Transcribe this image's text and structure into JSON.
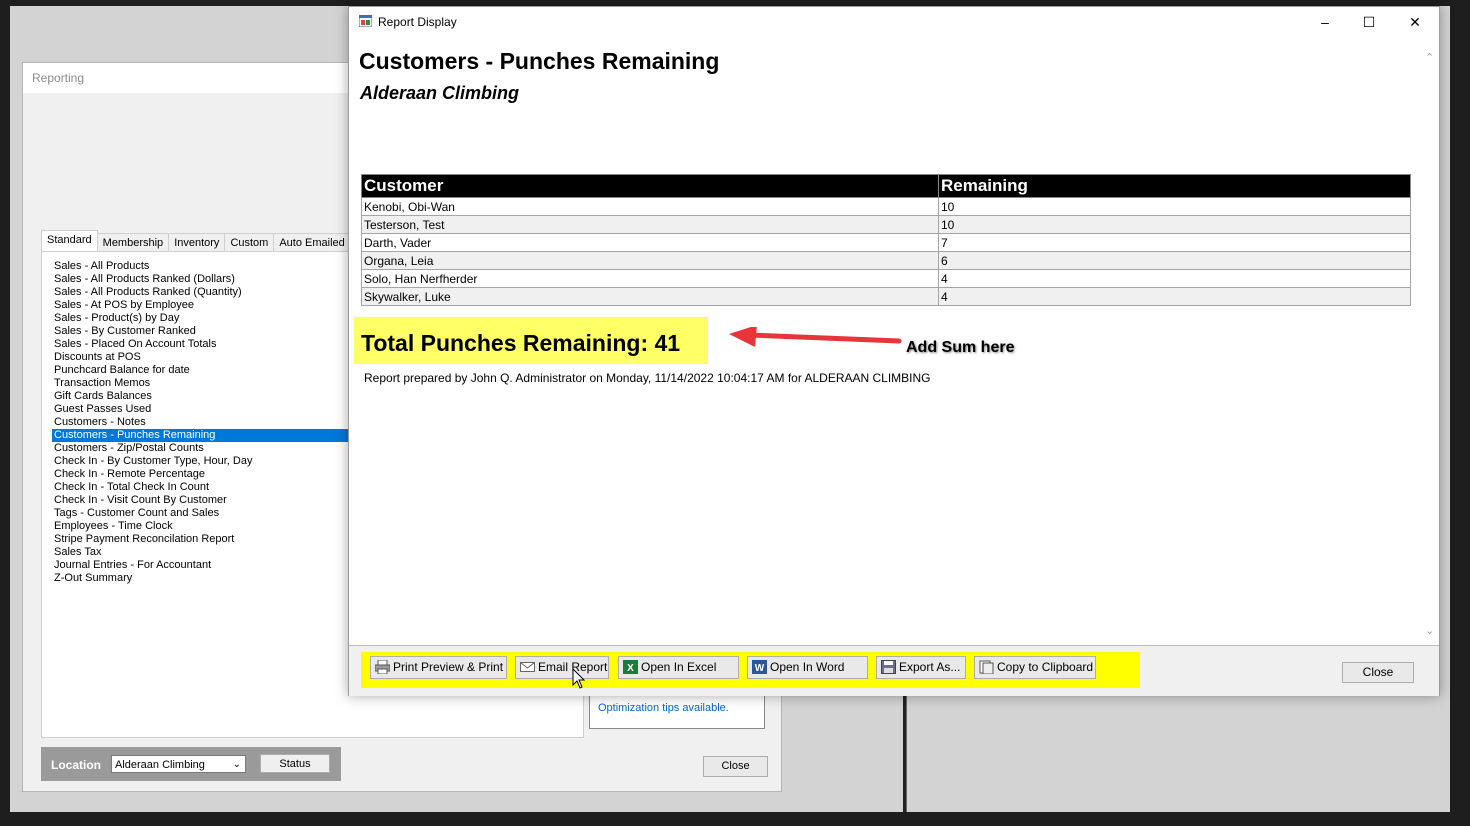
{
  "reporting": {
    "title": "Reporting",
    "tabs": [
      "Standard",
      "Membership",
      "Inventory",
      "Custom",
      "Auto Emailed R"
    ],
    "reports": [
      "Sales - All Products",
      "Sales - All Products Ranked (Dollars)",
      "Sales - All Products Ranked (Quantity)",
      "Sales - At POS by Employee",
      "Sales - Product(s) by Day",
      "Sales - By Customer Ranked",
      "Sales - Placed On Account Totals",
      "Discounts at POS",
      "Punchcard Balance for date",
      "Transaction Memos",
      "Gift Cards Balances",
      "Guest Passes Used",
      "Customers - Notes",
      "Customers - Punches Remaining",
      "Customers - Zip/Postal Counts",
      "Check In - By Customer Type, Hour, Day",
      "Check In - Remote Percentage",
      "Check In - Total Check In Count",
      "Check In - Visit Count By Customer",
      "Tags - Customer Count and Sales",
      "Employees - Time Clock",
      "Stripe Payment Reconcilation Report",
      "Sales Tax",
      "Journal Entries - For Accountant",
      "Z-Out Summary"
    ],
    "selected_report": "Customers - Punches Remaining",
    "optimization_tips": "Optimization tips available.",
    "location_label": "Location",
    "location_value": "Alderaan Climbing",
    "status_label": "Status",
    "close_label": "Close"
  },
  "report_window": {
    "title": "Report Display",
    "report_title": "Customers - Punches Remaining",
    "report_subtitle": "Alderaan Climbing",
    "columns": [
      "Customer",
      "Remaining"
    ],
    "rows": [
      [
        "Kenobi, Obi-Wan",
        "10"
      ],
      [
        "Testerson, Test",
        "10"
      ],
      [
        "Darth, Vader",
        "7"
      ],
      [
        "Organa, Leia",
        "6"
      ],
      [
        "Solo, Han Nerfherder",
        "4"
      ],
      [
        "Skywalker, Luke",
        "4"
      ]
    ],
    "total_text": "Total Punches Remaining: 41",
    "annotation": "Add Sum here",
    "prepared_text": "Report prepared by John Q. Administrator on Monday, 11/14/2022 10:04:17 AM for ALDERAAN CLIMBING",
    "toolbar": {
      "print": "Print Preview & Print",
      "email": "Email Report",
      "excel": "Open In Excel",
      "word": "Open In Word",
      "export": "Export As...",
      "clipboard": "Copy to Clipboard"
    },
    "close_label": "Close"
  },
  "colors": {
    "highlight": "#ffff00",
    "selection": "#0078d7",
    "arrow": "#e8343a"
  }
}
